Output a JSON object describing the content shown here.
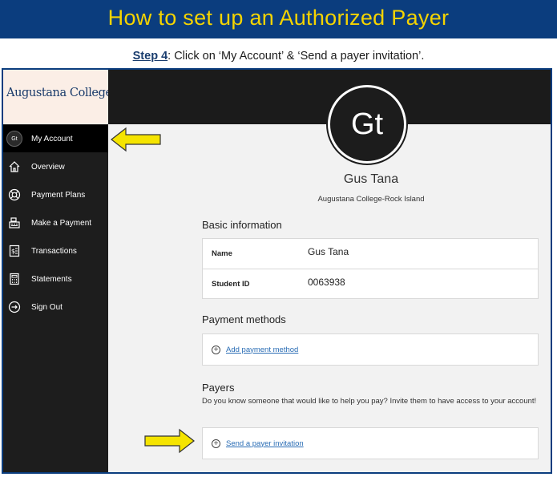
{
  "banner": {
    "title": "How to set up an Authorized Payer"
  },
  "step": {
    "number": "Step 4",
    "text": ":  Click on ‘My Account’ & ‘Send a payer invitation’."
  },
  "sidebar": {
    "logo": "Augustana College",
    "items": [
      {
        "label": "My Account",
        "icon": "avatar",
        "initials": "Gt",
        "active": true
      },
      {
        "label": "Overview",
        "icon": "home-icon"
      },
      {
        "label": "Payment Plans",
        "icon": "lifebuoy-icon"
      },
      {
        "label": "Make a Payment",
        "icon": "register-icon"
      },
      {
        "label": "Transactions",
        "icon": "receipt-icon"
      },
      {
        "label": "Statements",
        "icon": "calculator-icon"
      },
      {
        "label": "Sign Out",
        "icon": "sign-out-icon"
      }
    ]
  },
  "profile": {
    "initials": "Gt",
    "name": "Gus Tana",
    "school": "Augustana College-Rock Island"
  },
  "basic_info": {
    "title": "Basic information",
    "rows": [
      {
        "label": "Name",
        "value": "Gus Tana"
      },
      {
        "label": "Student ID",
        "value": "0063938"
      }
    ]
  },
  "payment_methods": {
    "title": "Payment methods",
    "add_label": "Add payment method"
  },
  "payers": {
    "title": "Payers",
    "description": "Do you know someone that would like to help you pay? Invite them to have access to your account!",
    "invite_label": "Send a payer invitation"
  },
  "colors": {
    "banner_bg": "#0b3d7e",
    "banner_text": "#f5d400",
    "sidebar_bg": "#1d1d1d",
    "link": "#2a6db5",
    "arrow": "#f5e400"
  }
}
